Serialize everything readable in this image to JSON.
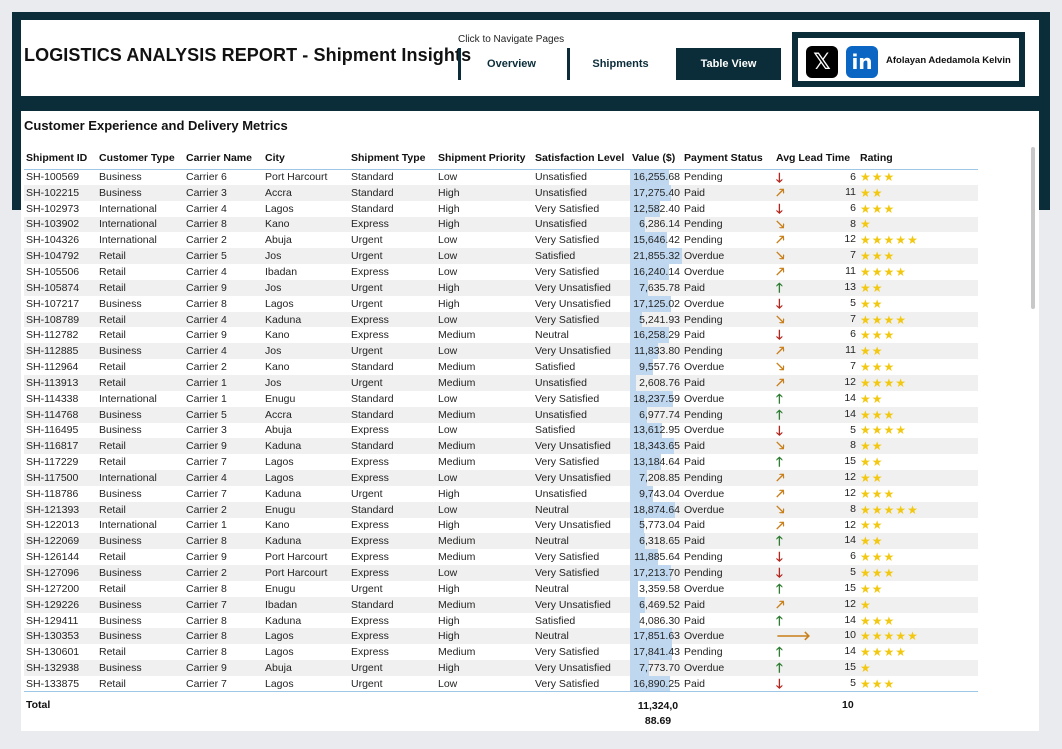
{
  "header": {
    "title": "LOGISTICS ANALYSIS REPORT - Shipment Insights",
    "nav_hint": "Click to Navigate Pages",
    "nav": [
      {
        "label": "Overview",
        "active": false
      },
      {
        "label": "Shipments",
        "active": false
      },
      {
        "label": "Table View",
        "active": true
      }
    ],
    "social": {
      "x_icon": "x-logo-icon",
      "linkedin_icon": "linkedin-logo-icon",
      "author": "Afolayan Adedamola Kelvin"
    }
  },
  "panel": {
    "title": "Customer Experience and Delivery Metrics",
    "columns": [
      "Shipment ID",
      "Customer Type",
      "Carrier Name",
      "City",
      "Shipment Type",
      "Shipment Priority",
      "Satisfaction Level",
      "Value ($)",
      "Payment Status",
      "Avg Lead Time",
      "Rating"
    ],
    "value_max": 21855.32,
    "rows": [
      [
        "SH-100569",
        "Business",
        "Carrier 6",
        "Port Harcourt",
        "Standard",
        "Low",
        "Unsatisfied",
        16255.68,
        "16,255.68",
        "Pending",
        "down",
        6,
        3
      ],
      [
        "SH-102215",
        "Business",
        "Carrier 3",
        "Accra",
        "Standard",
        "High",
        "Unsatisfied",
        17275.4,
        "17,275.40",
        "Paid",
        "up-right",
        11,
        2
      ],
      [
        "SH-102973",
        "International",
        "Carrier 4",
        "Lagos",
        "Standard",
        "High",
        "Very Satisfied",
        12582.4,
        "12,582.40",
        "Paid",
        "down",
        6,
        3
      ],
      [
        "SH-103902",
        "International",
        "Carrier 8",
        "Kano",
        "Express",
        "High",
        "Unsatisfied",
        6286.14,
        "6,286.14",
        "Pending",
        "down-right",
        8,
        1
      ],
      [
        "SH-104326",
        "International",
        "Carrier 2",
        "Abuja",
        "Urgent",
        "Low",
        "Very Satisfied",
        15646.42,
        "15,646.42",
        "Pending",
        "up-right",
        12,
        5
      ],
      [
        "SH-104792",
        "Retail",
        "Carrier 5",
        "Jos",
        "Urgent",
        "Low",
        "Satisfied",
        21855.32,
        "21,855.32",
        "Overdue",
        "down-right",
        7,
        3
      ],
      [
        "SH-105506",
        "Retail",
        "Carrier 4",
        "Ibadan",
        "Express",
        "Low",
        "Very Satisfied",
        16240.14,
        "16,240.14",
        "Overdue",
        "up-right",
        11,
        4
      ],
      [
        "SH-105874",
        "Retail",
        "Carrier 9",
        "Jos",
        "Urgent",
        "High",
        "Very Unsatisfied",
        7635.78,
        "7,635.78",
        "Paid",
        "up",
        13,
        2
      ],
      [
        "SH-107217",
        "Business",
        "Carrier 8",
        "Lagos",
        "Urgent",
        "High",
        "Very Unsatisfied",
        17125.02,
        "17,125.02",
        "Overdue",
        "down",
        5,
        2
      ],
      [
        "SH-108789",
        "Retail",
        "Carrier 4",
        "Kaduna",
        "Express",
        "Low",
        "Very Satisfied",
        5241.93,
        "5,241.93",
        "Pending",
        "down-right",
        7,
        4
      ],
      [
        "SH-112782",
        "Retail",
        "Carrier 9",
        "Kano",
        "Express",
        "Medium",
        "Neutral",
        16258.29,
        "16,258.29",
        "Paid",
        "down",
        6,
        3
      ],
      [
        "SH-112885",
        "Business",
        "Carrier 4",
        "Jos",
        "Urgent",
        "Low",
        "Very Unsatisfied",
        11833.8,
        "11,833.80",
        "Pending",
        "up-right",
        11,
        2
      ],
      [
        "SH-112964",
        "Retail",
        "Carrier 2",
        "Kano",
        "Standard",
        "Medium",
        "Satisfied",
        9557.76,
        "9,557.76",
        "Overdue",
        "down-right",
        7,
        3
      ],
      [
        "SH-113913",
        "Retail",
        "Carrier 1",
        "Jos",
        "Urgent",
        "Medium",
        "Unsatisfied",
        2608.76,
        "2,608.76",
        "Paid",
        "up-right",
        12,
        4
      ],
      [
        "SH-114338",
        "International",
        "Carrier 1",
        "Enugu",
        "Standard",
        "Low",
        "Very Satisfied",
        18237.59,
        "18,237.59",
        "Overdue",
        "up",
        14,
        2
      ],
      [
        "SH-114768",
        "Business",
        "Carrier 5",
        "Accra",
        "Standard",
        "Medium",
        "Unsatisfied",
        6977.74,
        "6,977.74",
        "Pending",
        "up",
        14,
        3
      ],
      [
        "SH-116495",
        "Business",
        "Carrier 3",
        "Abuja",
        "Express",
        "Low",
        "Satisfied",
        13612.95,
        "13,612.95",
        "Overdue",
        "down",
        5,
        4
      ],
      [
        "SH-116817",
        "Retail",
        "Carrier 9",
        "Kaduna",
        "Standard",
        "Medium",
        "Very Unsatisfied",
        18343.65,
        "18,343.65",
        "Paid",
        "down-right",
        8,
        2
      ],
      [
        "SH-117229",
        "Retail",
        "Carrier 7",
        "Lagos",
        "Express",
        "Medium",
        "Very Satisfied",
        13184.64,
        "13,184.64",
        "Paid",
        "up",
        15,
        2
      ],
      [
        "SH-117500",
        "International",
        "Carrier 4",
        "Lagos",
        "Express",
        "Low",
        "Very Unsatisfied",
        7208.85,
        "7,208.85",
        "Pending",
        "up-right",
        12,
        2
      ],
      [
        "SH-118786",
        "Business",
        "Carrier 7",
        "Kaduna",
        "Urgent",
        "High",
        "Unsatisfied",
        9743.04,
        "9,743.04",
        "Overdue",
        "up-right",
        12,
        3
      ],
      [
        "SH-121393",
        "Retail",
        "Carrier 2",
        "Enugu",
        "Standard",
        "Low",
        "Neutral",
        18874.64,
        "18,874.64",
        "Overdue",
        "down-right",
        8,
        5
      ],
      [
        "SH-122013",
        "International",
        "Carrier 1",
        "Kano",
        "Express",
        "High",
        "Very Unsatisfied",
        5773.04,
        "5,773.04",
        "Paid",
        "up-right",
        12,
        2
      ],
      [
        "SH-122069",
        "Business",
        "Carrier 8",
        "Kaduna",
        "Express",
        "Medium",
        "Neutral",
        6318.65,
        "6,318.65",
        "Paid",
        "up",
        14,
        2
      ],
      [
        "SH-126144",
        "Retail",
        "Carrier 9",
        "Port Harcourt",
        "Express",
        "Medium",
        "Very Satisfied",
        11885.64,
        "11,885.64",
        "Pending",
        "down",
        6,
        3
      ],
      [
        "SH-127096",
        "Business",
        "Carrier 2",
        "Port Harcourt",
        "Express",
        "Low",
        "Very Satisfied",
        17213.7,
        "17,213.70",
        "Pending",
        "down",
        5,
        3
      ],
      [
        "SH-127200",
        "Retail",
        "Carrier 8",
        "Enugu",
        "Urgent",
        "High",
        "Neutral",
        3359.58,
        "3,359.58",
        "Overdue",
        "up",
        15,
        2
      ],
      [
        "SH-129226",
        "Business",
        "Carrier 7",
        "Ibadan",
        "Standard",
        "Medium",
        "Very Unsatisfied",
        6469.52,
        "6,469.52",
        "Paid",
        "up-right",
        12,
        1
      ],
      [
        "SH-129411",
        "Business",
        "Carrier 8",
        "Kaduna",
        "Express",
        "High",
        "Satisfied",
        4086.3,
        "4,086.30",
        "Paid",
        "up",
        14,
        3
      ],
      [
        "SH-130353",
        "Business",
        "Carrier 8",
        "Lagos",
        "Express",
        "High",
        "Neutral",
        17851.63,
        "17,851.63",
        "Overdue",
        "right",
        10,
        5
      ],
      [
        "SH-130601",
        "Retail",
        "Carrier 8",
        "Lagos",
        "Express",
        "Medium",
        "Very Satisfied",
        17841.43,
        "17,841.43",
        "Pending",
        "up",
        14,
        4
      ],
      [
        "SH-132938",
        "Business",
        "Carrier 9",
        "Abuja",
        "Urgent",
        "High",
        "Very Unsatisfied",
        7773.7,
        "7,773.70",
        "Overdue",
        "up",
        15,
        1
      ],
      [
        "SH-133875",
        "Retail",
        "Carrier 7",
        "Lagos",
        "Urgent",
        "Low",
        "Very Satisfied",
        16890.25,
        "16,890.25",
        "Paid",
        "down",
        5,
        3
      ]
    ],
    "total": {
      "label": "Total",
      "value_line1": "11,324,0",
      "value_line2": "88.69",
      "lead": "10"
    }
  },
  "colors": {
    "navy": "#0b2d3a",
    "bar": "#bfd8f0",
    "star": "#f2c811",
    "arrow_down": "#b3261e",
    "arrow_up": "#2e7d32",
    "arrow_diag": "#c87f1a"
  }
}
